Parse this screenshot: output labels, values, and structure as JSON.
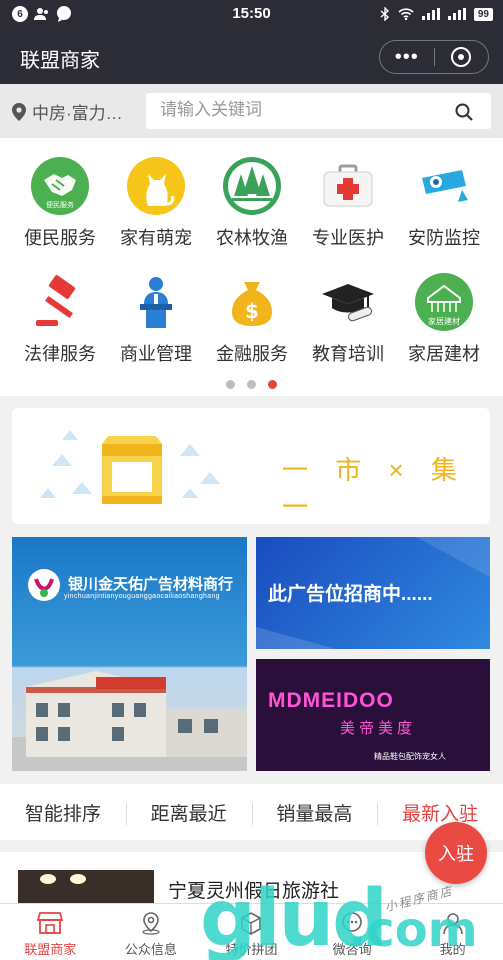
{
  "status_bar": {
    "time": "15:50",
    "notification_count": "6",
    "battery": "99"
  },
  "nav": {
    "title": "联盟商家"
  },
  "search": {
    "location": "中房·富力…",
    "placeholder": "请输入关键词"
  },
  "categories": [
    {
      "label": "便民服务",
      "icon": "handshake-icon",
      "icon_text": "便民服务"
    },
    {
      "label": "家有萌宠",
      "icon": "cat-icon"
    },
    {
      "label": "农林牧渔",
      "icon": "trees-icon"
    },
    {
      "label": "专业医护",
      "icon": "medical-kit-icon"
    },
    {
      "label": "安防监控",
      "icon": "security-camera-icon"
    },
    {
      "label": "法律服务",
      "icon": "gavel-icon"
    },
    {
      "label": "商业管理",
      "icon": "speaker-podium-icon"
    },
    {
      "label": "金融服务",
      "icon": "money-bag-icon"
    },
    {
      "label": "教育培训",
      "icon": "graduation-cap-icon"
    },
    {
      "label": "家居建材",
      "icon": "house-icon",
      "icon_text": "家居建材"
    }
  ],
  "carousel": {
    "pages": 3,
    "active": 3
  },
  "market_banner": {
    "text": "一 市 × 集 一"
  },
  "ads": {
    "left_name": "银川金天佑广告材料商行",
    "left_pinyin": "yinchuanjintianyouguanggaocailiaoshanghang",
    "top_right": "此广告位招商中......",
    "bottom_right_brand": "MDMEIDOO",
    "bottom_right_cn": "美帝美度",
    "bottom_right_tag": "精品鞋包配饰宠女人"
  },
  "sort_tabs": [
    {
      "label": "智能排序",
      "active": false
    },
    {
      "label": "距离最近",
      "active": false
    },
    {
      "label": "销量最高",
      "active": false
    },
    {
      "label": "最新入驻",
      "active": true
    }
  ],
  "floating_button": {
    "label": "入驻"
  },
  "listing": {
    "name": "宁夏灵州假日旅游社"
  },
  "tabs": [
    {
      "label": "联盟商家",
      "icon": "store-icon",
      "active": true
    },
    {
      "label": "公众信息",
      "icon": "location-pin-icon",
      "active": false
    },
    {
      "label": "特价拼团",
      "icon": "box-icon",
      "active": false
    },
    {
      "label": "微咨询",
      "icon": "chat-bubble-icon",
      "active": false
    },
    {
      "label": "我的",
      "icon": "person-icon",
      "active": false
    }
  ],
  "watermark": {
    "brand": "glud",
    "brand_suffix": ".com",
    "sub": "小程序商店"
  },
  "colors": {
    "accent": "#e54343",
    "nav_bg": "#2c2c36",
    "gold": "#f1b41c",
    "green": "#4caf50"
  }
}
